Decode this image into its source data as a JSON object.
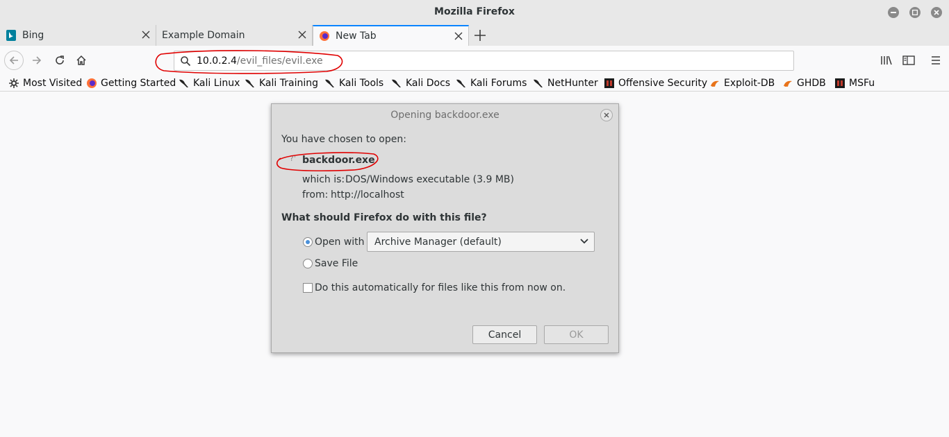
{
  "window": {
    "title": "Mozilla Firefox"
  },
  "tabs": [
    {
      "label": "Bing",
      "active": false
    },
    {
      "label": "Example Domain",
      "active": false
    },
    {
      "label": "New Tab",
      "active": true
    }
  ],
  "urlbar": {
    "host": "10.0.2.4",
    "path": "/evil_files/evil.exe"
  },
  "bookmarks": [
    {
      "label": "Most Visited",
      "icon": "gear-icon"
    },
    {
      "label": "Getting Started",
      "icon": "firefox-icon"
    },
    {
      "label": "Kali Linux",
      "icon": "kali-dragon-icon"
    },
    {
      "label": "Kali Training",
      "icon": "kali-dragon-icon"
    },
    {
      "label": "Kali Tools",
      "icon": "kali-dragon-icon"
    },
    {
      "label": "Kali Docs",
      "icon": "kali-dragon-icon"
    },
    {
      "label": "Kali Forums",
      "icon": "kali-dragon-icon"
    },
    {
      "label": "NetHunter",
      "icon": "kali-dragon-icon"
    },
    {
      "label": "Offensive Security",
      "icon": "offsec-icon"
    },
    {
      "label": "Exploit-DB",
      "icon": "exploitdb-icon"
    },
    {
      "label": "GHDB",
      "icon": "exploitdb-icon"
    },
    {
      "label": "MSFu",
      "icon": "offsec-icon"
    }
  ],
  "dialog": {
    "title": "Opening backdoor.exe",
    "chosen_label": "You have chosen to open:",
    "filename": "backdoor.exe",
    "which_is_label": "which is:",
    "which_is_value": "DOS/Windows executable (3.9 MB)",
    "from_label": "from:",
    "from_value": "http://localhost",
    "question": "What should Firefox do with this file?",
    "open_with_label": "Open with",
    "open_with_app": "Archive Manager (default)",
    "save_file_label": "Save File",
    "auto_label": "Do this automatically for files like this from now on.",
    "cancel_label": "Cancel",
    "ok_label": "OK",
    "open_with_selected": true,
    "auto_checked": false
  },
  "colors": {
    "accent": "#0a84ff",
    "annotation": "#e00000"
  }
}
